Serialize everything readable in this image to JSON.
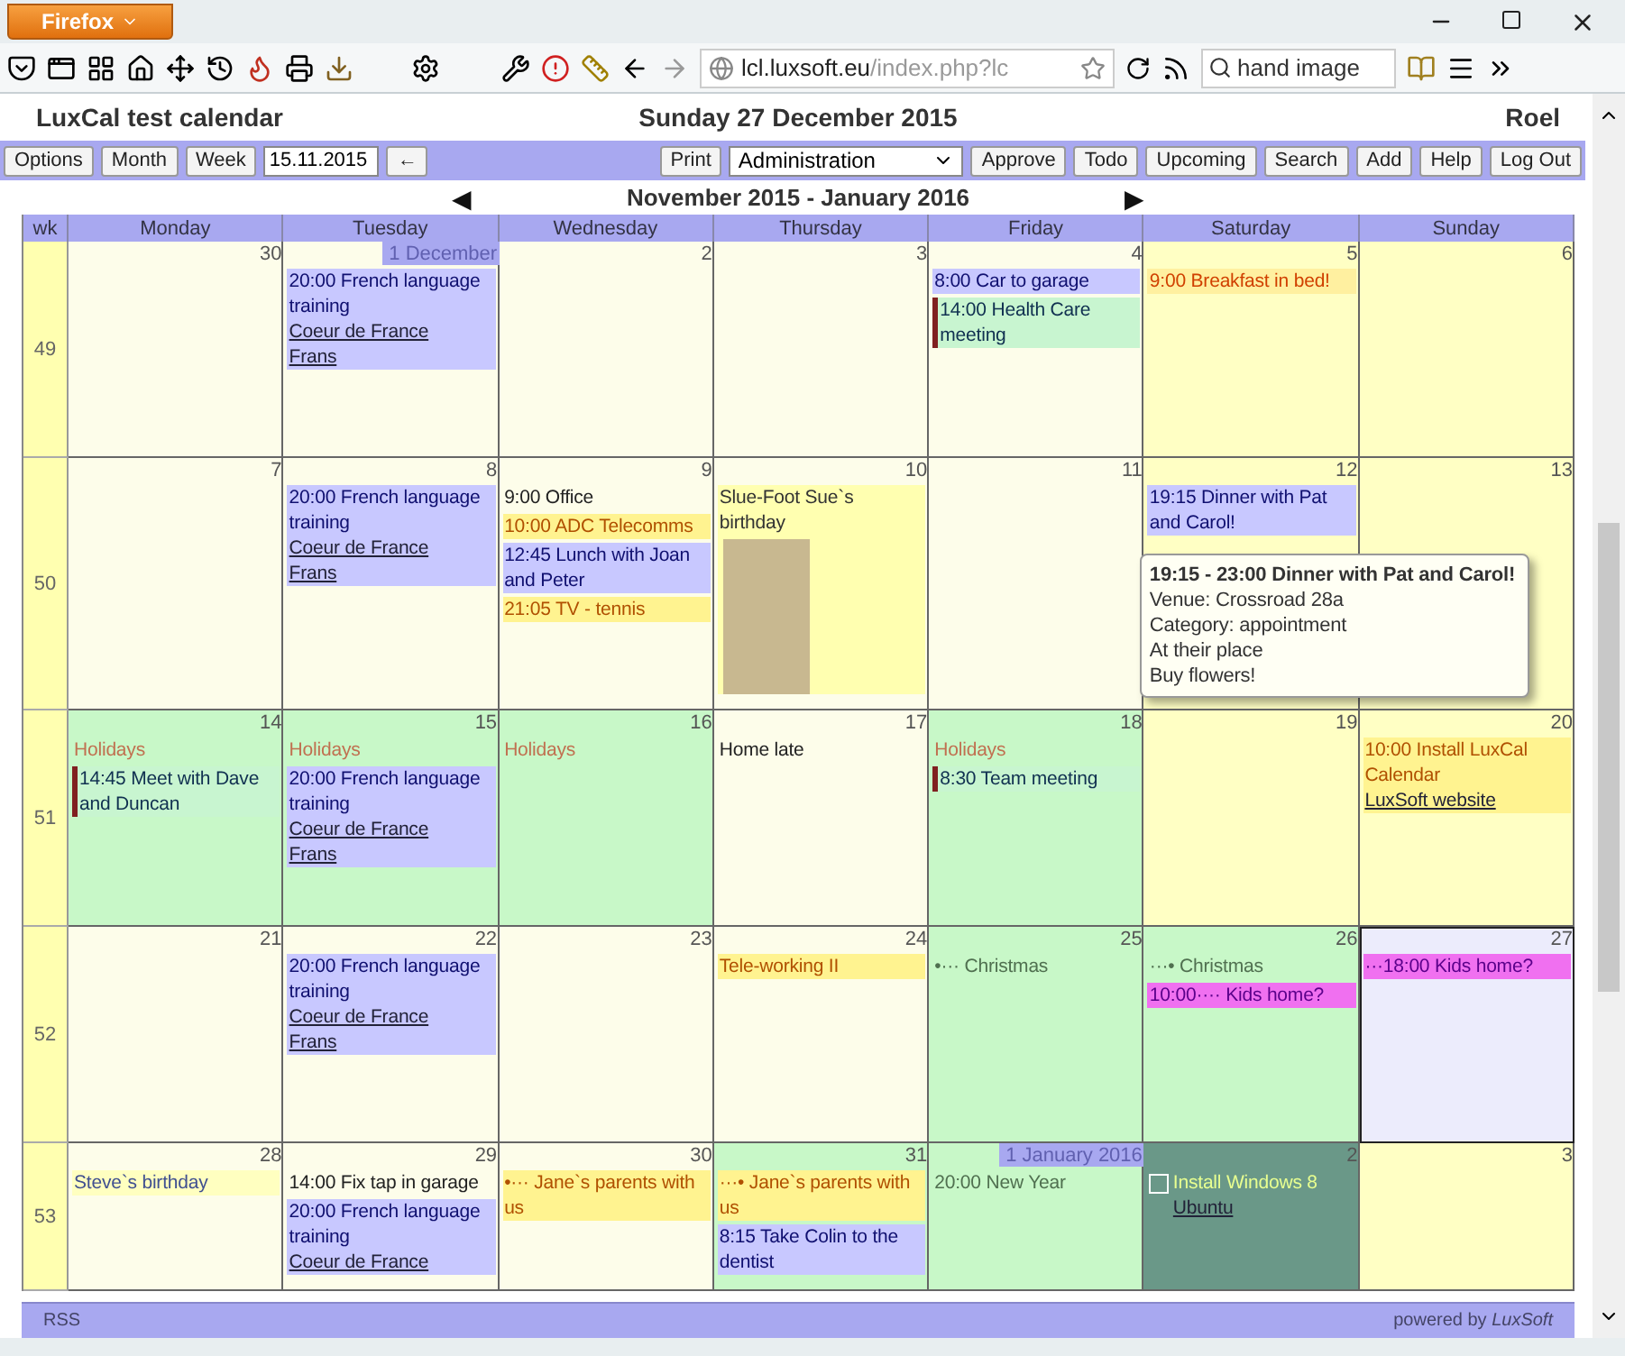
{
  "browser": {
    "app_button": "Firefox",
    "url_host": "lcl.luxsoft.eu",
    "url_path": "/index.php?lc",
    "search": "hand image"
  },
  "header": {
    "title": "LuxCal test calendar",
    "date": "Sunday 27 December 2015",
    "user": "Roel"
  },
  "toolbar": {
    "left": [
      "Options",
      "Month",
      "Week"
    ],
    "date_field": "15.11.2015",
    "back": "←",
    "print": "Print",
    "select": "Administration",
    "right": [
      "Approve",
      "Todo",
      "Upcoming",
      "Search",
      "Add",
      "Help",
      "Log Out"
    ]
  },
  "nav": {
    "prev": "◀",
    "title": "November 2015 - January 2016",
    "next": "▶"
  },
  "columns": [
    "wk",
    "Monday",
    "Tuesday",
    "Wednesday",
    "Thursday",
    "Friday",
    "Saturday",
    "Sunday"
  ],
  "weeks": [
    {
      "number": "49",
      "days": [
        {
          "label": "30",
          "kind": "weekday",
          "month_start": false
        },
        {
          "label": "1 December",
          "kind": "weekday",
          "month_start": true,
          "events": [
            {
              "kind": "blue",
              "text": "20:00 French language training",
              "links": [
                "Coeur de France",
                "Frans"
              ],
              "flagged": false
            }
          ]
        },
        {
          "label": "2",
          "kind": "weekday",
          "month_start": false
        },
        {
          "label": "3",
          "kind": "weekday",
          "month_start": false
        },
        {
          "label": "4",
          "kind": "weekday",
          "month_start": false,
          "events": [
            {
              "kind": "blue",
              "text": "8:00 Car to garage",
              "flagged": false
            },
            {
              "kind": "green",
              "text": "14:00 Health Care meeting",
              "flagged": true
            }
          ]
        },
        {
          "label": "5",
          "kind": "weekend",
          "month_start": false,
          "events": [
            {
              "kind": "orange",
              "text": "9:00 Breakfast in bed!",
              "flagged": false
            }
          ]
        },
        {
          "label": "6",
          "kind": "weekend",
          "month_start": false
        }
      ]
    },
    {
      "number": "50",
      "days": [
        {
          "label": "7",
          "kind": "weekday",
          "month_start": false
        },
        {
          "label": "8",
          "kind": "weekday",
          "month_start": false,
          "events": [
            {
              "kind": "blue",
              "text": "20:00 French language training",
              "links": [
                "Coeur de France",
                "Frans"
              ],
              "flagged": false
            }
          ]
        },
        {
          "label": "9",
          "kind": "weekday",
          "month_start": false,
          "events": [
            {
              "kind": "plain",
              "text": "9:00 Office",
              "flagged": false
            },
            {
              "kind": "yellow",
              "text": "10:00 ADC Telecomms",
              "flagged": false
            },
            {
              "kind": "blue",
              "text": "12:45 Lunch with Joan and Peter",
              "flagged": false
            },
            {
              "kind": "yellow",
              "text": "21:05 TV - tennis",
              "flagged": false
            }
          ]
        },
        {
          "label": "10",
          "kind": "weekday",
          "month_start": false,
          "events": [
            {
              "kind": "birthday",
              "text": "Slue-Foot Sue`s birthday",
              "flagged": false
            }
          ]
        },
        {
          "label": "11",
          "kind": "weekday",
          "month_start": false
        },
        {
          "label": "12",
          "kind": "weekend",
          "month_start": false,
          "events": [
            {
              "kind": "blue",
              "text": "19:15 Dinner with Pat and Carol!",
              "flagged": false,
              "tooltip": {
                "title": "19:15 - 23:00 Dinner with Pat and Carol!",
                "lines": [
                  "Venue: Crossroad 28a",
                  "Category: appointment",
                  "At their place",
                  "Buy flowers!"
                ]
              }
            }
          ]
        },
        {
          "label": "13",
          "kind": "weekend",
          "month_start": false
        }
      ]
    },
    {
      "number": "51",
      "days": [
        {
          "label": "14",
          "kind": "holiday",
          "month_start": false,
          "events": [
            {
              "kind": "holiday",
              "text": "Holidays",
              "flagged": false
            },
            {
              "kind": "green",
              "text": "14:45 Meet with Dave and Duncan",
              "flagged": true
            }
          ]
        },
        {
          "label": "15",
          "kind": "holiday",
          "month_start": false,
          "events": [
            {
              "kind": "holiday",
              "text": "Holidays",
              "flagged": false
            },
            {
              "kind": "blue",
              "text": "20:00 French language training",
              "links": [
                "Coeur de France",
                "Frans"
              ],
              "flagged": false
            }
          ]
        },
        {
          "label": "16",
          "kind": "holiday",
          "month_start": false,
          "events": [
            {
              "kind": "holiday",
              "text": "Holidays",
              "flagged": false
            }
          ]
        },
        {
          "label": "17",
          "kind": "weekday",
          "month_start": false,
          "events": [
            {
              "kind": "plain",
              "text": "Home late",
              "flagged": false
            }
          ]
        },
        {
          "label": "18",
          "kind": "holiday",
          "month_start": false,
          "events": [
            {
              "kind": "holiday",
              "text": "Holidays",
              "flagged": false
            },
            {
              "kind": "green",
              "text": "8:30 Team meeting",
              "flagged": true
            }
          ]
        },
        {
          "label": "19",
          "kind": "weekend",
          "month_start": false
        },
        {
          "label": "20",
          "kind": "weekend",
          "month_start": false,
          "events": [
            {
              "kind": "yellow",
              "text": "10:00 Install LuxCal Calendar",
              "links": [
                "LuxSoft website"
              ],
              "flagged": false
            }
          ]
        }
      ]
    },
    {
      "number": "52",
      "days": [
        {
          "label": "21",
          "kind": "weekday",
          "month_start": false
        },
        {
          "label": "22",
          "kind": "weekday",
          "month_start": false,
          "events": [
            {
              "kind": "blue",
              "text": "20:00 French language training",
              "links": [
                "Coeur de France",
                "Frans"
              ],
              "flagged": false
            }
          ]
        },
        {
          "label": "23",
          "kind": "weekday",
          "month_start": false
        },
        {
          "label": "24",
          "kind": "weekday",
          "month_start": false,
          "events": [
            {
              "kind": "yellow",
              "text": "Tele-working II",
              "flagged": false
            }
          ]
        },
        {
          "label": "25",
          "kind": "holiday",
          "month_start": false,
          "events": [
            {
              "kind": "grey",
              "text": "•··· Christmas",
              "flagged": false
            }
          ]
        },
        {
          "label": "26",
          "kind": "holiday",
          "month_start": false,
          "events": [
            {
              "kind": "grey",
              "text": "···• Christmas",
              "flagged": false
            },
            {
              "kind": "magenta",
              "text": "10:00···· Kids home?",
              "flagged": false
            }
          ]
        },
        {
          "label": "27",
          "kind": "today",
          "month_start": false,
          "events": [
            {
              "kind": "magenta",
              "text": "···18:00 Kids home?",
              "flagged": false
            }
          ]
        }
      ]
    },
    {
      "number": "53",
      "days": [
        {
          "label": "28",
          "kind": "weekday",
          "month_start": false,
          "events": [
            {
              "kind": "pale",
              "text": "Steve`s birthday",
              "flagged": false
            }
          ]
        },
        {
          "label": "29",
          "kind": "weekday",
          "month_start": false,
          "events": [
            {
              "kind": "plain",
              "text": "14:00 Fix tap in garage",
              "flagged": false
            },
            {
              "kind": "blue",
              "text": "20:00 French language training",
              "links": [
                "Coeur de France"
              ],
              "flagged": false
            }
          ]
        },
        {
          "label": "30",
          "kind": "weekday",
          "month_start": false,
          "events": [
            {
              "kind": "yellow",
              "text": "•··· Jane`s parents with us",
              "flagged": false
            }
          ]
        },
        {
          "label": "31",
          "kind": "holiday",
          "month_start": false,
          "events": [
            {
              "kind": "yellow",
              "text": "···• Jane`s parents with us",
              "flagged": false
            },
            {
              "kind": "blue",
              "text": "8:15 Take Colin to the dentist",
              "flagged": false
            }
          ]
        },
        {
          "label": "1 January 2016",
          "kind": "holiday",
          "month_start": true,
          "events": [
            {
              "kind": "grey",
              "text": "20:00 New Year",
              "flagged": false
            }
          ]
        },
        {
          "label": "2",
          "kind": "done",
          "month_start": false,
          "events": [
            {
              "kind": "task",
              "text": "Install Windows 8",
              "links": [
                "Ubuntu"
              ],
              "flagged": false,
              "checked": false
            }
          ]
        },
        {
          "label": "3",
          "kind": "weekend",
          "month_start": false
        }
      ]
    }
  ],
  "footer": {
    "rss": "RSS",
    "powered": "powered by *LuxSoft*"
  }
}
